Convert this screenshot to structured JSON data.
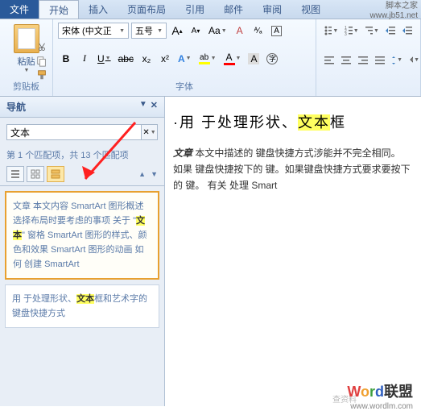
{
  "watermark": {
    "line1": "脚本之家",
    "line2": "www.jb51.net"
  },
  "tabs": {
    "file": "文件",
    "home": "开始",
    "insert": "插入",
    "layout": "页面布局",
    "references": "引用",
    "mailings": "邮件",
    "review": "审阅",
    "view": "视图"
  },
  "ribbon": {
    "clipboard": {
      "paste": "粘贴",
      "label": "剪贴板"
    },
    "font": {
      "family": "宋体 (中文正",
      "size": "五号",
      "label": "字体",
      "bold": "B",
      "italic": "I",
      "underline": "U",
      "strike": "abc",
      "sub": "x₂",
      "sup": "x²",
      "grow": "A",
      "shrink": "A",
      "case": "Aa",
      "clear": "⌫"
    },
    "para": {
      "highlight_color": "#ffff00",
      "font_color": "#ff0000"
    }
  },
  "nav": {
    "title": "导航",
    "search_value": "文本",
    "match_count": "第 1 个匹配项，共 13 个匹配项",
    "results": [
      {
        "text_before": "文章 本文内容 SmartArt 图形概述 选择布局时要考虑的事项 关于 \"",
        "match": "文本",
        "text_after": "\" 窗格 SmartArt 图形的样式、颜色和效果 SmartArt 图形的动画 如何 创建 SmartArt"
      },
      {
        "text_before": "用 于处理形状、",
        "match": "文本",
        "text_after": "框和艺术字的键盘快捷方式"
      }
    ]
  },
  "document": {
    "title_before": "·用 于处理形状、",
    "title_match": "文本",
    "title_after": "框",
    "body_prefix": "文章",
    "body": " 本文中描述的 键盘快捷方式涉能并不完全相同。 如果 键盘快捷按下的 键。如果键盘快捷方式要求要按下的 键。 有关 处理 Smart"
  },
  "footer": {
    "logo_w": "W",
    "logo_o": "o",
    "logo_r": "r",
    "logo_d": "d",
    "logo_rest": "联盟",
    "url": "www.wordlm.com",
    "wm": "查资料"
  }
}
